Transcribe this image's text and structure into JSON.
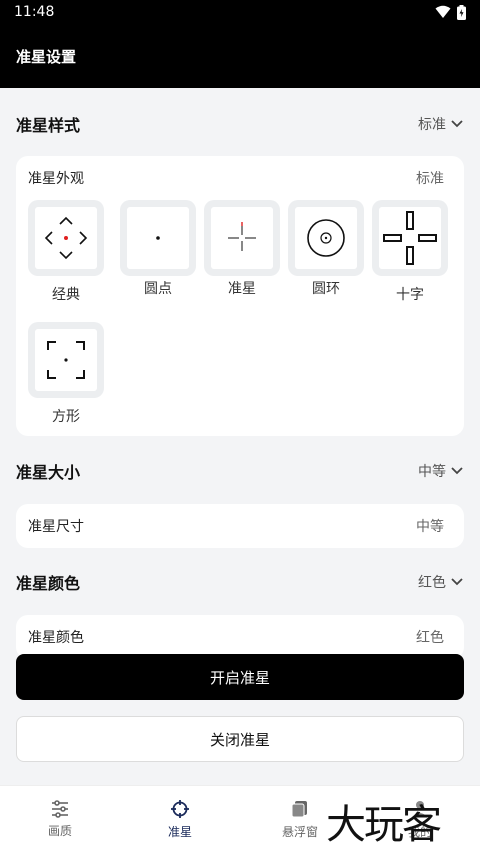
{
  "status_bar": {
    "time": "11:48"
  },
  "app": {
    "title": "准星设置"
  },
  "style_section": {
    "title": "准星样式",
    "value": "标准",
    "card": {
      "label": "准星外观",
      "value": "标准",
      "options": [
        {
          "label": "经典",
          "icon": "classic-crosshair-icon"
        },
        {
          "label": "圆点",
          "icon": "dot-crosshair-icon"
        },
        {
          "label": "准星",
          "icon": "thin-crosshair-icon"
        },
        {
          "label": "圆环",
          "icon": "ring-crosshair-icon"
        },
        {
          "label": "十字",
          "icon": "cross-crosshair-icon"
        },
        {
          "label": "方形",
          "icon": "square-crosshair-icon"
        }
      ]
    }
  },
  "size_section": {
    "title": "准星大小",
    "value": "中等",
    "card": {
      "label": "准星尺寸",
      "value": "中等"
    }
  },
  "color_section": {
    "title": "准星颜色",
    "value": "红色",
    "card": {
      "label": "准星颜色",
      "value": "红色"
    }
  },
  "buttons": {
    "enable": "开启准星",
    "disable": "关闭准星"
  },
  "tabs": [
    {
      "label": "画质",
      "icon": "sliders-icon",
      "active": false
    },
    {
      "label": "准星",
      "icon": "crosshair-icon",
      "active": true
    },
    {
      "label": "悬浮窗",
      "icon": "window-icon",
      "active": false
    },
    {
      "label": "我的",
      "icon": "user-icon",
      "active": false
    }
  ],
  "watermark": {
    "text": "大玩客"
  },
  "colors": {
    "accent": "#000000",
    "active_tab": "#1a2a5a",
    "crosshair_red": "#e02020"
  }
}
